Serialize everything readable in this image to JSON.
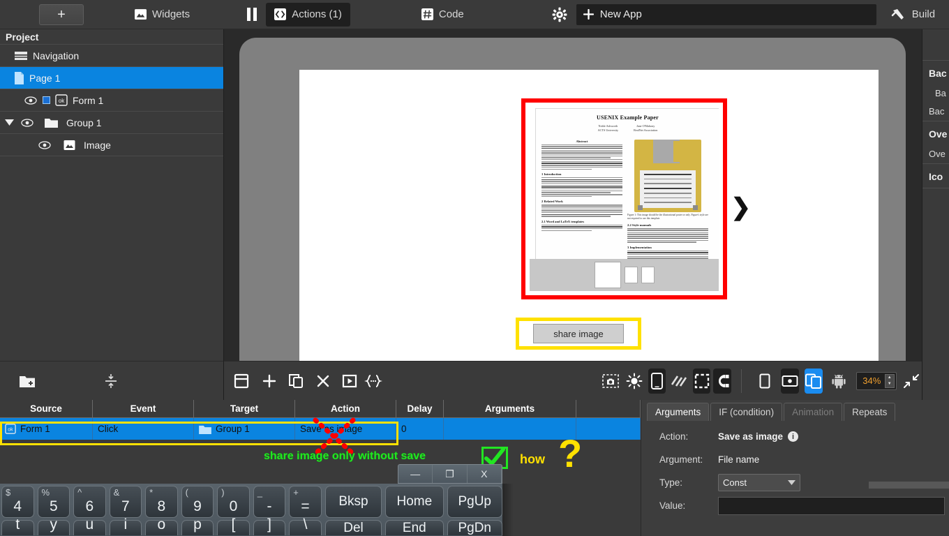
{
  "topbar": {
    "add_label": "+",
    "items": [
      {
        "label": "Widgets",
        "icon": "image-icon"
      },
      {
        "label": "Actions (1)",
        "icon": "code-brackets-icon"
      },
      {
        "label": "Code",
        "icon": "grid-hash-icon"
      }
    ],
    "pause_icon": "pause-icon",
    "gear_icon": "gear-icon",
    "new_app_label": "New App",
    "build_label": "Build",
    "build_icon": "hammer-icon"
  },
  "project": {
    "header": "Project",
    "items": [
      {
        "label": "Navigation",
        "icon": "navigation-icon",
        "depth": 1,
        "selected": false,
        "eye": false,
        "check": false,
        "arrow": false
      },
      {
        "label": "Page 1",
        "icon": "page-icon",
        "depth": 1,
        "selected": true,
        "eye": false,
        "check": false,
        "arrow": false
      },
      {
        "label": "Form 1",
        "icon": "ok-box-icon",
        "depth": 2,
        "selected": false,
        "eye": true,
        "check": true,
        "arrow": false
      },
      {
        "label": "Group 1",
        "icon": "folder-icon",
        "depth": 2,
        "selected": false,
        "eye": true,
        "check": false,
        "arrow": true
      },
      {
        "label": "Image",
        "icon": "image-icon",
        "depth": 3,
        "selected": false,
        "eye": true,
        "check": false,
        "arrow": false
      }
    ],
    "bottom_tools": [
      {
        "name": "add-folder-icon"
      },
      {
        "name": "distribute-vertical-icon"
      }
    ]
  },
  "canvas": {
    "paper": {
      "title": "USENIX Example Paper",
      "authors": [
        {
          "name": "Noble Ashworth",
          "affil": "ACTS University"
        },
        {
          "name": "Jane O'Mahony",
          "affil": "RealNet Association"
        }
      ],
      "sections": [
        "Abstract",
        "1 Introduction",
        "2 Related Work",
        "2.1 Word and LaTeX templates",
        "2.2 Style manuals",
        "3 Implementation"
      ],
      "figure_caption": "Figure 1: This image should be the illustrational poster or only. Figure's style are not required to use this template."
    },
    "share_button_label": "share image",
    "next_arrow_icon": "chevron-right-icon",
    "selection_box_color": "#ff0000",
    "button_highlight_color": "#ffe100"
  },
  "canvas_toolbar": {
    "left_icons": [
      {
        "name": "frame-icon"
      },
      {
        "name": "plus-icon"
      },
      {
        "name": "duplicate-icon"
      },
      {
        "name": "close-x-icon"
      },
      {
        "name": "play-box-icon"
      },
      {
        "name": "braces-icon"
      }
    ],
    "mid_icons": [
      {
        "name": "screenshot-icon"
      },
      {
        "name": "brightness-icon"
      },
      {
        "name": "phone-icon",
        "active": true
      },
      {
        "name": "diagonal-stripes-icon"
      },
      {
        "name": "marquee-select-icon"
      },
      {
        "name": "magnet-icon",
        "active": true
      }
    ],
    "right_icons": [
      {
        "name": "portrait-icon"
      },
      {
        "name": "landscape-icon",
        "active": true
      },
      {
        "name": "both-orientation-icon",
        "active": true,
        "accent": "#1a8cf0"
      },
      {
        "name": "android-icon"
      }
    ],
    "zoom_value": "34%",
    "fit_icon": "fit-screen-icon"
  },
  "right_panel": {
    "sections": [
      {
        "title": "Bac",
        "rows": [
          "Ba",
          "Bac"
        ]
      },
      {
        "title": "Ove",
        "rows": [
          "Ove"
        ]
      },
      {
        "title": "Ico",
        "rows": []
      }
    ]
  },
  "actions_table": {
    "columns": [
      "Source",
      "Event",
      "Target",
      "Action",
      "Delay",
      "Arguments",
      ""
    ],
    "rows": [
      {
        "source": "Form 1",
        "source_icon": "ok-box-icon",
        "event": "Click",
        "target": "Group 1",
        "target_icon": "folder-icon",
        "action": "Save as image",
        "delay": "0",
        "arguments": "",
        "end": ""
      }
    ]
  },
  "annotations": {
    "green_note": "share image only without save",
    "how_label": "how",
    "question_mark": "?",
    "check_color": "#22e622",
    "highlight_color": "#ffe100",
    "strike_color": "#ff0000"
  },
  "arguments_panel": {
    "tabs": [
      {
        "label": "Arguments",
        "state": "active"
      },
      {
        "label": "IF (condition)",
        "state": "normal"
      },
      {
        "label": "Animation",
        "state": "disabled"
      },
      {
        "label": "Repeats",
        "state": "normal"
      }
    ],
    "action_label": "Action:",
    "action_value": "Save as image",
    "argument_label": "Argument:",
    "argument_value": "File name",
    "type_label": "Type:",
    "type_value": "Const",
    "value_label": "Value:",
    "value_value": ""
  },
  "window_controls": {
    "minimize": "—",
    "maximize": "❐",
    "close": "X"
  },
  "keyboard": {
    "row1": [
      {
        "main": "4",
        "sup": "$"
      },
      {
        "main": "5",
        "sup": "%"
      },
      {
        "main": "6",
        "sup": "^"
      },
      {
        "main": "7",
        "sup": "&"
      },
      {
        "main": "8",
        "sup": "*"
      },
      {
        "main": "9",
        "sup": "("
      },
      {
        "main": "0",
        "sup": ")"
      },
      {
        "main": "-",
        "sup": "_"
      },
      {
        "main": "=",
        "sup": "+"
      },
      {
        "main": "Bksp",
        "sup": ""
      },
      {
        "main": "Home",
        "sup": ""
      },
      {
        "main": "PgUp",
        "sup": ""
      }
    ],
    "row2": [
      {
        "main": "t",
        "sup": ""
      },
      {
        "main": "y",
        "sup": ""
      },
      {
        "main": "u",
        "sup": ""
      },
      {
        "main": "i",
        "sup": ""
      },
      {
        "main": "o",
        "sup": ""
      },
      {
        "main": "p",
        "sup": ""
      },
      {
        "main": "[",
        "sup": "{"
      },
      {
        "main": "]",
        "sup": "}"
      },
      {
        "main": "\\",
        "sup": "|"
      },
      {
        "main": "Del",
        "sup": ""
      },
      {
        "main": "End",
        "sup": ""
      },
      {
        "main": "PgDn",
        "sup": ""
      }
    ]
  }
}
